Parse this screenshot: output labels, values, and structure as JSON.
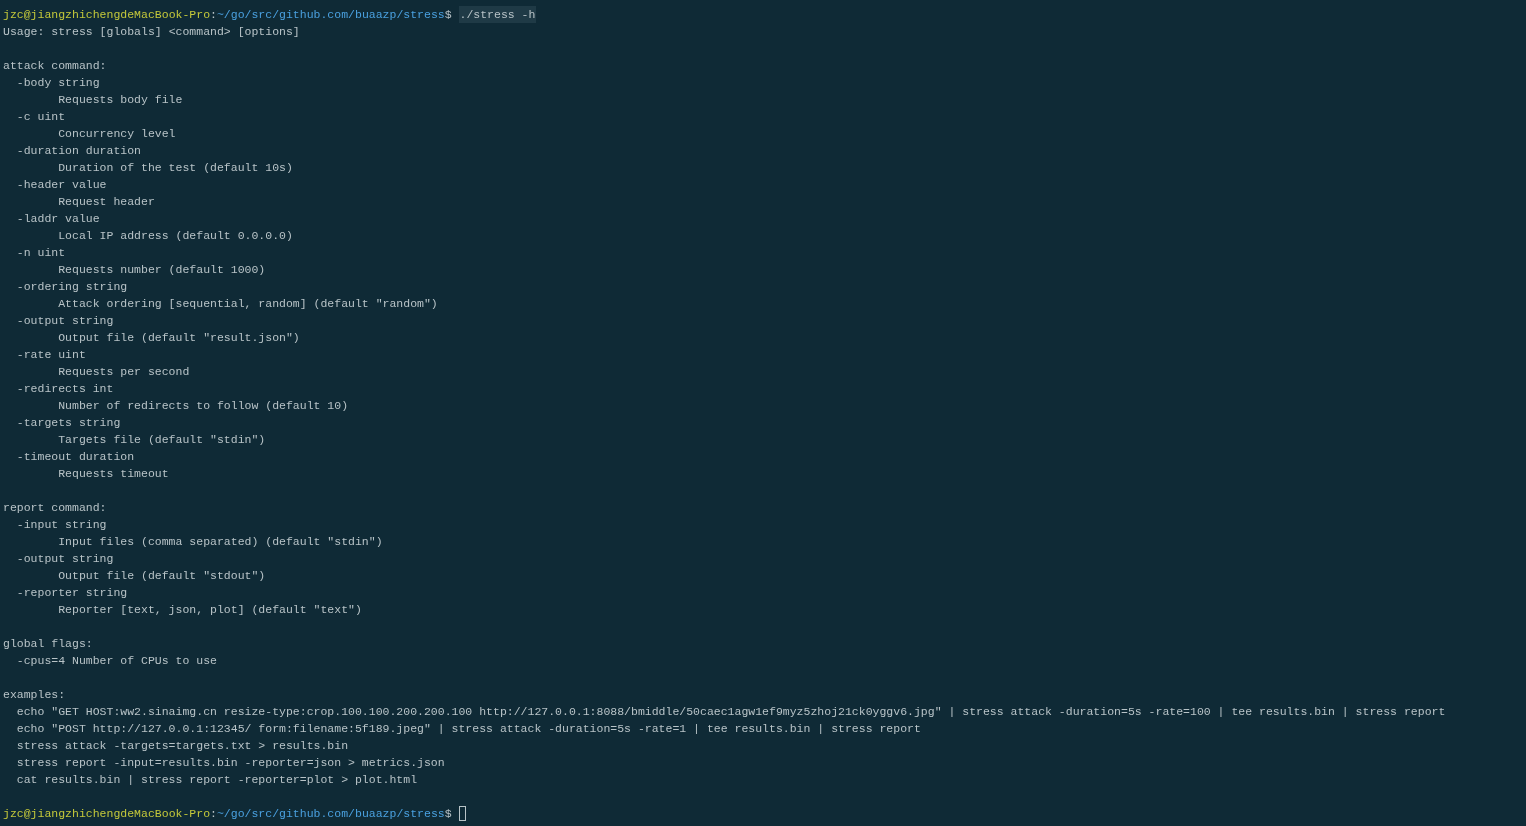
{
  "prompt": {
    "user_host": "jzc@jiangzhichengdeMacBook-Pro",
    "separator": ":",
    "path": "~/go/src/github.com/buaazp/stress",
    "symbol": "$",
    "command": "./stress -h",
    "highlighted": true
  },
  "output": [
    {
      "kind": "heading",
      "text": "Usage: stress [globals] <command> [options]"
    },
    {
      "kind": "blank"
    },
    {
      "kind": "heading",
      "text": "attack command:"
    },
    {
      "kind": "flag",
      "text": "-body string"
    },
    {
      "kind": "desc",
      "text": "Requests body file"
    },
    {
      "kind": "flag",
      "text": "-c uint"
    },
    {
      "kind": "desc",
      "text": "Concurrency level"
    },
    {
      "kind": "flag",
      "text": "-duration duration"
    },
    {
      "kind": "desc",
      "text": "Duration of the test (default 10s)"
    },
    {
      "kind": "flag",
      "text": "-header value"
    },
    {
      "kind": "desc",
      "text": "Request header"
    },
    {
      "kind": "flag",
      "text": "-laddr value"
    },
    {
      "kind": "desc",
      "text": "Local IP address (default 0.0.0.0)"
    },
    {
      "kind": "flag",
      "text": "-n uint"
    },
    {
      "kind": "desc",
      "text": "Requests number (default 1000)"
    },
    {
      "kind": "flag",
      "text": "-ordering string"
    },
    {
      "kind": "desc",
      "text": "Attack ordering [sequential, random] (default \"random\")"
    },
    {
      "kind": "flag",
      "text": "-output string"
    },
    {
      "kind": "desc",
      "text": "Output file (default \"result.json\")"
    },
    {
      "kind": "flag",
      "text": "-rate uint"
    },
    {
      "kind": "desc",
      "text": "Requests per second"
    },
    {
      "kind": "flag",
      "text": "-redirects int"
    },
    {
      "kind": "desc",
      "text": "Number of redirects to follow (default 10)"
    },
    {
      "kind": "flag",
      "text": "-targets string"
    },
    {
      "kind": "desc",
      "text": "Targets file (default \"stdin\")"
    },
    {
      "kind": "flag",
      "text": "-timeout duration"
    },
    {
      "kind": "desc",
      "text": "Requests timeout"
    },
    {
      "kind": "blank"
    },
    {
      "kind": "heading",
      "text": "report command:"
    },
    {
      "kind": "flag",
      "text": "-input string"
    },
    {
      "kind": "desc",
      "text": "Input files (comma separated) (default \"stdin\")"
    },
    {
      "kind": "flag",
      "text": "-output string"
    },
    {
      "kind": "desc",
      "text": "Output file (default \"stdout\")"
    },
    {
      "kind": "flag",
      "text": "-reporter string"
    },
    {
      "kind": "desc",
      "text": "Reporter [text, json, plot] (default \"text\")"
    },
    {
      "kind": "blank"
    },
    {
      "kind": "heading",
      "text": "global flags:"
    },
    {
      "kind": "flag",
      "text": "-cpus=4 Number of CPUs to use"
    },
    {
      "kind": "blank"
    },
    {
      "kind": "heading",
      "text": "examples:"
    },
    {
      "kind": "flag",
      "text": "echo \"GET HOST:ww2.sinaimg.cn resize-type:crop.100.100.200.200.100 http://127.0.0.1:8088/bmiddle/50caec1agw1ef9myz5zhoj21ck0yggv6.jpg\" | stress attack -duration=5s -rate=100 | tee results.bin | stress report"
    },
    {
      "kind": "flag",
      "text": "echo \"POST http://127.0.0.1:12345/ form:filename:5f189.jpeg\" | stress attack -duration=5s -rate=1 | tee results.bin | stress report"
    },
    {
      "kind": "flag",
      "text": "stress attack -targets=targets.txt > results.bin"
    },
    {
      "kind": "flag",
      "text": "stress report -input=results.bin -reporter=json > metrics.json"
    },
    {
      "kind": "flag",
      "text": "cat results.bin | stress report -reporter=plot > plot.html"
    },
    {
      "kind": "blank"
    }
  ],
  "final_prompt": {
    "user_host": "jzc@jiangzhichengdeMacBook-Pro",
    "separator": ":",
    "path": "~/go/src/github.com/buaazp/stress",
    "symbol": "$",
    "cursor": true
  }
}
